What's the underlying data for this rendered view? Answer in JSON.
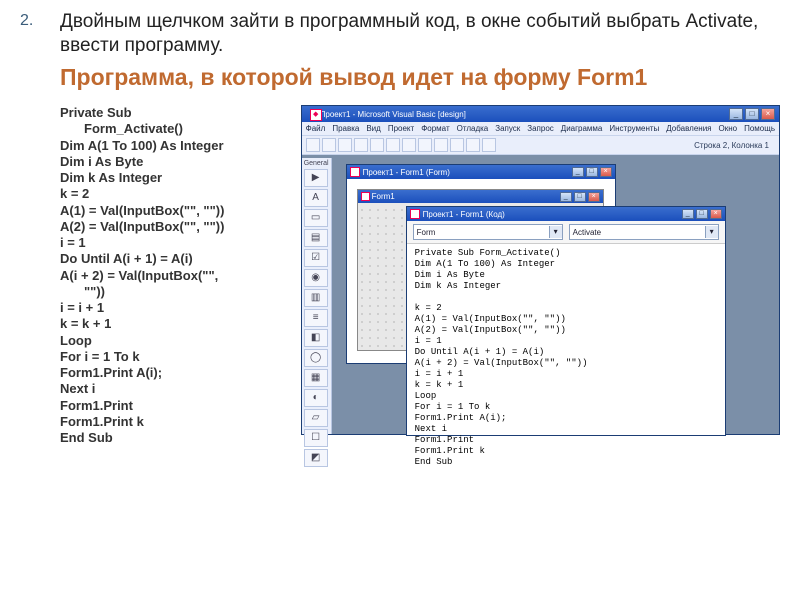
{
  "bullet_number": "2.",
  "intro": "Двойным щелчком зайти в программный код, в окне событий выбрать Activate, ввести программу.",
  "subtitle": "Программа, в которой вывод идет на форму Form1",
  "code_lines": [
    "Private Sub",
    "        Form_Activate()",
    "Dim A(1 To 100) As Integer",
    "Dim i As Byte",
    "Dim k As Integer",
    "k = 2",
    "A(1) = Val(InputBox(\"\", \"\"))",
    "A(2) = Val(InputBox(\"\", \"\"))",
    "i = 1",
    "Do Until A(i + 1) = A(i)",
    "A(i + 2) = Val(InputBox(\"\",",
    "        \"\"))",
    "i = i + 1",
    "k = k + 1",
    "Loop",
    "For i = 1 To k",
    "Form1.Print A(i);",
    "Next i",
    "Form1.Print",
    "Form1.Print k",
    "End Sub"
  ],
  "ide": {
    "title": "Проект1 - Microsoft Visual Basic [design]",
    "menus": [
      "Файл",
      "Правка",
      "Вид",
      "Проект",
      "Формат",
      "Отладка",
      "Запуск",
      "Запрос",
      "Диаграмма",
      "Инструменты",
      "Добавления",
      "Окно",
      "Помощь"
    ],
    "status": "Строка 2, Колонка 1",
    "toolbox_label": "General",
    "toolbox_glyphs": [
      "▶",
      "A",
      "▭",
      "▤",
      "☑",
      "◉",
      "▥",
      "≡",
      "◧",
      "◯",
      "▦",
      "◐",
      "▱",
      "☐",
      "◩"
    ]
  },
  "formwin": {
    "title": "Проект1 - Form1 (Form)",
    "form_caption": "Form1"
  },
  "codewin": {
    "title": "Проект1 - Form1 (Код)",
    "object": "Form",
    "proc": "Activate",
    "lines": [
      "Private Sub Form_Activate()",
      "Dim A(1 To 100) As Integer",
      "Dim i As Byte",
      "Dim k As Integer",
      "",
      "k = 2",
      "A(1) = Val(InputBox(\"\", \"\"))",
      "A(2) = Val(InputBox(\"\", \"\"))",
      "i = 1",
      "Do Until A(i + 1) = A(i)",
      "A(i + 2) = Val(InputBox(\"\", \"\"))",
      "i = i + 1",
      "k = k + 1",
      "Loop",
      "For i = 1 To k",
      "Form1.Print A(i);",
      "Next i",
      "Form1.Print",
      "Form1.Print k",
      "End Sub"
    ]
  }
}
